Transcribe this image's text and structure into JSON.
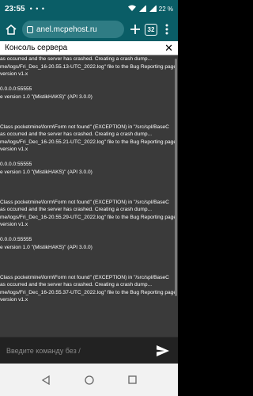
{
  "status_bar": {
    "time": "23:55",
    "notification_dots": "• • •",
    "battery": "22 %"
  },
  "browser": {
    "url": "anel.mcpehost.ru",
    "tab_count": "32"
  },
  "console": {
    "title": "Консоль сервера",
    "lines": [
      "as occurred and the server has crashed. Creating a crash dump...",
      "me/logs/Fri_Dec_16-20.55.13-UTC_2022.log\" file to the Bug Reporting page",
      " version v1.x",
      "",
      "0.0.0.0:55555",
      "e version 1.0 \"(MistikHAKS)\" (API 3.0.0)",
      "",
      "",
      "",
      "Class pocketmine\\form\\Form not found\" (EXCEPTION) in \"/src/spl/BaseC",
      "as occurred and the server has crashed. Creating a crash dump...",
      "me/logs/Fri_Dec_16-20.55.21-UTC_2022.log\" file to the Bug Reporting page",
      " version v1.x",
      "",
      "0.0.0.0:55555",
      "e version 1.0 \"(MistikHAKS)\" (API 3.0.0)",
      "",
      "",
      "",
      "Class pocketmine\\form\\Form not found\" (EXCEPTION) in \"/src/spl/BaseC",
      "as occurred and the server has crashed. Creating a crash dump...",
      "me/logs/Fri_Dec_16-20.55.29-UTC_2022.log\" file to the Bug Reporting page",
      " version v1.x",
      "",
      "0.0.0.0:55555",
      "e version 1.0 \"(MistikHAKS)\" (API 3.0.0)",
      "",
      "",
      "",
      "Class pocketmine\\form\\Form not found\" (EXCEPTION) in \"/src/spl/BaseC",
      "as occurred and the server has crashed. Creating a crash dump...",
      "me/logs/Fri_Dec_16-20.55.37-UTC_2022.log\" file to the Bug Reporting page",
      " version v1.x",
      "",
      ""
    ],
    "input_placeholder": "Введите команду без /"
  }
}
